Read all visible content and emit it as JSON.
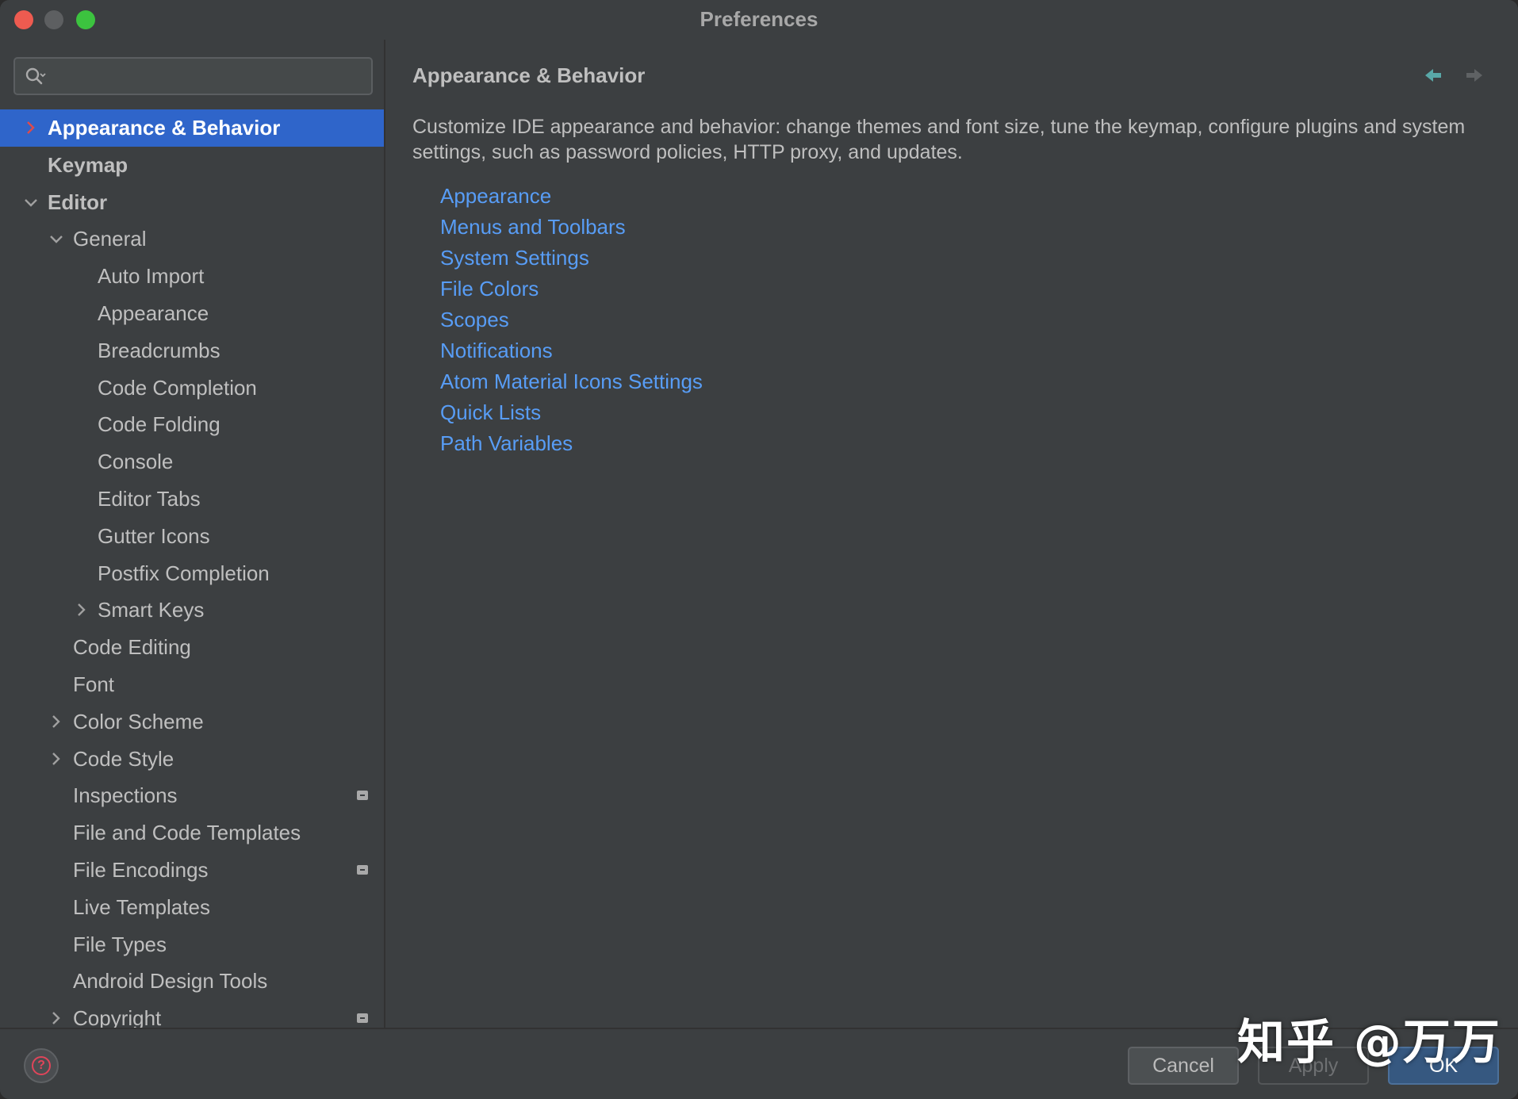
{
  "window": {
    "title": "Preferences"
  },
  "search": {
    "placeholder": ""
  },
  "sidebar": {
    "items": [
      {
        "label": "Appearance & Behavior",
        "indent": 0,
        "arrow": "right",
        "selected": true,
        "bold": true,
        "badge": false
      },
      {
        "label": "Keymap",
        "indent": 0,
        "arrow": "none",
        "selected": false,
        "bold": true,
        "badge": false
      },
      {
        "label": "Editor",
        "indent": 0,
        "arrow": "down",
        "selected": false,
        "bold": true,
        "badge": false
      },
      {
        "label": "General",
        "indent": 1,
        "arrow": "down",
        "selected": false,
        "bold": false,
        "badge": false
      },
      {
        "label": "Auto Import",
        "indent": 2,
        "arrow": "none",
        "selected": false,
        "bold": false,
        "badge": false
      },
      {
        "label": "Appearance",
        "indent": 2,
        "arrow": "none",
        "selected": false,
        "bold": false,
        "badge": false
      },
      {
        "label": "Breadcrumbs",
        "indent": 2,
        "arrow": "none",
        "selected": false,
        "bold": false,
        "badge": false
      },
      {
        "label": "Code Completion",
        "indent": 2,
        "arrow": "none",
        "selected": false,
        "bold": false,
        "badge": false
      },
      {
        "label": "Code Folding",
        "indent": 2,
        "arrow": "none",
        "selected": false,
        "bold": false,
        "badge": false
      },
      {
        "label": "Console",
        "indent": 2,
        "arrow": "none",
        "selected": false,
        "bold": false,
        "badge": false
      },
      {
        "label": "Editor Tabs",
        "indent": 2,
        "arrow": "none",
        "selected": false,
        "bold": false,
        "badge": false
      },
      {
        "label": "Gutter Icons",
        "indent": 2,
        "arrow": "none",
        "selected": false,
        "bold": false,
        "badge": false
      },
      {
        "label": "Postfix Completion",
        "indent": 2,
        "arrow": "none",
        "selected": false,
        "bold": false,
        "badge": false
      },
      {
        "label": "Smart Keys",
        "indent": 2,
        "arrow": "right",
        "selected": false,
        "bold": false,
        "badge": false
      },
      {
        "label": "Code Editing",
        "indent": 1,
        "arrow": "none",
        "selected": false,
        "bold": false,
        "badge": false
      },
      {
        "label": "Font",
        "indent": 1,
        "arrow": "none",
        "selected": false,
        "bold": false,
        "badge": false
      },
      {
        "label": "Color Scheme",
        "indent": 1,
        "arrow": "right",
        "selected": false,
        "bold": false,
        "badge": false
      },
      {
        "label": "Code Style",
        "indent": 1,
        "arrow": "right",
        "selected": false,
        "bold": false,
        "badge": false
      },
      {
        "label": "Inspections",
        "indent": 1,
        "arrow": "none",
        "selected": false,
        "bold": false,
        "badge": true
      },
      {
        "label": "File and Code Templates",
        "indent": 1,
        "arrow": "none",
        "selected": false,
        "bold": false,
        "badge": false
      },
      {
        "label": "File Encodings",
        "indent": 1,
        "arrow": "none",
        "selected": false,
        "bold": false,
        "badge": true
      },
      {
        "label": "Live Templates",
        "indent": 1,
        "arrow": "none",
        "selected": false,
        "bold": false,
        "badge": false
      },
      {
        "label": "File Types",
        "indent": 1,
        "arrow": "none",
        "selected": false,
        "bold": false,
        "badge": false
      },
      {
        "label": "Android Design Tools",
        "indent": 1,
        "arrow": "none",
        "selected": false,
        "bold": false,
        "badge": false
      },
      {
        "label": "Copyright",
        "indent": 1,
        "arrow": "right",
        "selected": false,
        "bold": false,
        "badge": true
      }
    ]
  },
  "main": {
    "title": "Appearance & Behavior",
    "description": "Customize IDE appearance and behavior: change themes and font size, tune the keymap, configure plugins and system settings, such as password policies, HTTP proxy, and updates.",
    "links": [
      "Appearance",
      "Menus and Toolbars",
      "System Settings",
      "File Colors",
      "Scopes",
      "Notifications",
      "Atom Material Icons Settings",
      "Quick Lists",
      "Path Variables"
    ]
  },
  "footer": {
    "cancel_label": "Cancel",
    "apply_label": "Apply",
    "ok_label": "OK",
    "watermark": "知乎 @万万"
  },
  "colors": {
    "background": "#3c3f41",
    "selection": "#2f65ca",
    "link": "#589df6",
    "text": "#bfbfbf",
    "back_arrow": "#59a8a8",
    "help_icon": "#e0455a",
    "ok_button": "#365880"
  },
  "icons": {
    "search": "search-icon",
    "back": "arrow-left-icon",
    "forward": "arrow-right-icon",
    "help": "question-circle-icon",
    "badge": "project-level-icon"
  }
}
